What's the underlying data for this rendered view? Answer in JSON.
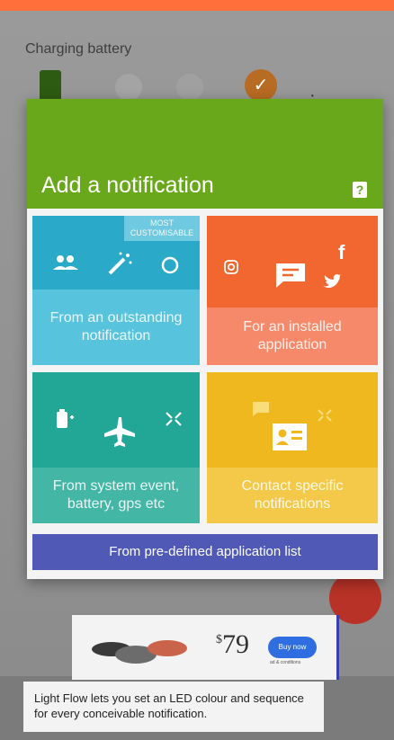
{
  "background": {
    "charging_label": "Charging battery"
  },
  "dialog": {
    "title": "Add a notification",
    "help_icon": "?",
    "tiles": [
      {
        "label": "From an outstanding notification",
        "badge": "MOST CUSTOMISABLE",
        "color": "#2aa9c9"
      },
      {
        "label": "For an installed application",
        "color": "#f2662f"
      },
      {
        "label": "From system event, battery, gps etc",
        "color": "#22a696"
      },
      {
        "label": "Contact specific notifications",
        "color": "#f0b81f"
      }
    ],
    "bottom_button": "From pre-defined application list",
    "header_color": "#6aa81b",
    "button_color": "#5059b6"
  },
  "ad": {
    "price": "79",
    "currency": "$",
    "buy_label": "Buy now",
    "note": "ad & conditions"
  },
  "caption": "Light Flow lets you set an LED colour and sequence for every conceivable notification."
}
